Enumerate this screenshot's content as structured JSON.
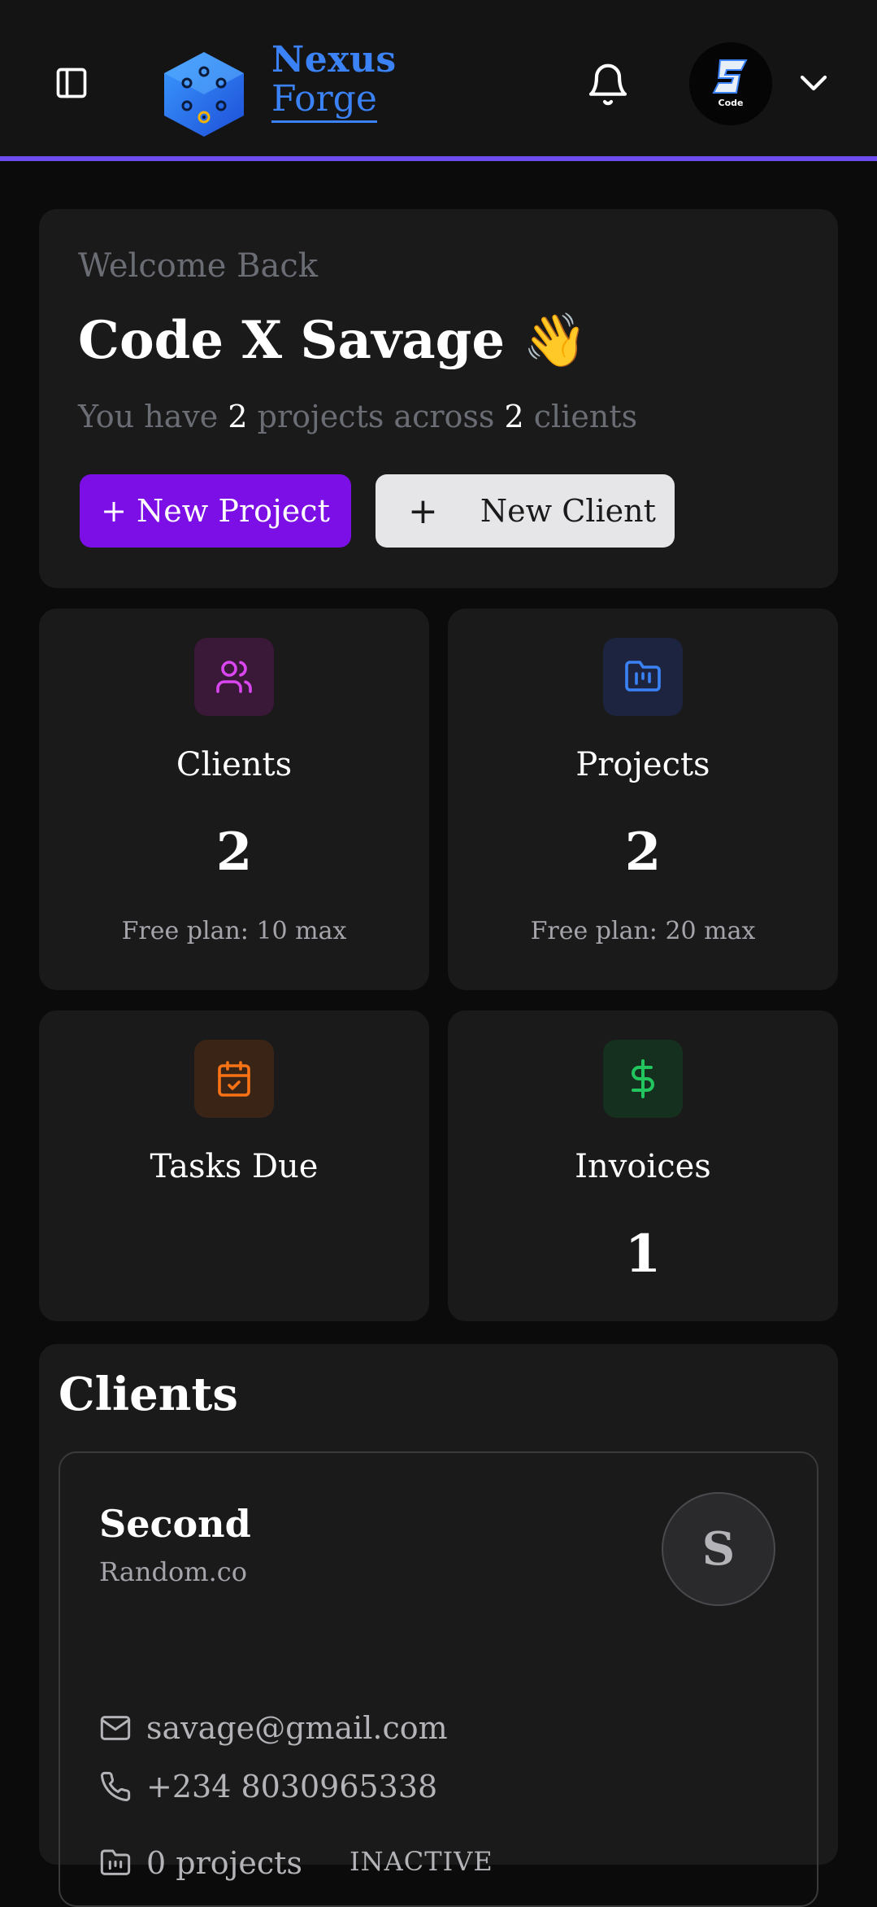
{
  "header": {
    "brand_line1": "Nexus",
    "brand_line2": "Forge",
    "accent_color": "#6d4cf0",
    "brand_color": "#3b82f6"
  },
  "welcome": {
    "subtitle": "Welcome Back",
    "name": "Code X Savage 👋",
    "summary_prefix": "You have ",
    "project_count": "2",
    "summary_middle": " projects across ",
    "client_count": "2",
    "summary_suffix": " clients",
    "new_project_label": "+ New Project",
    "new_client_plus": "+",
    "new_client_label": "New Client"
  },
  "stats": {
    "clients": {
      "label": "Clients",
      "value": "2",
      "note": "Free plan: 10 max",
      "icon": "users-icon",
      "color": "#d946ef"
    },
    "projects": {
      "label": "Projects",
      "value": "2",
      "note": "Free plan: 20 max",
      "icon": "folder-chart-icon",
      "color": "#3b82f6"
    },
    "tasks": {
      "label": "Tasks Due",
      "value": "",
      "icon": "calendar-check-icon",
      "color": "#f97316"
    },
    "invoices": {
      "label": "Invoices",
      "value": "1",
      "icon": "dollar-icon",
      "color": "#22c55e"
    }
  },
  "clients_section": {
    "title": "Clients",
    "items": [
      {
        "name": "Second",
        "company": "Random.co",
        "initial": "S",
        "email": "savage@gmail.com",
        "phone": "+234 8030965338",
        "projects": "0 projects",
        "status": "INACTIVE"
      }
    ]
  }
}
